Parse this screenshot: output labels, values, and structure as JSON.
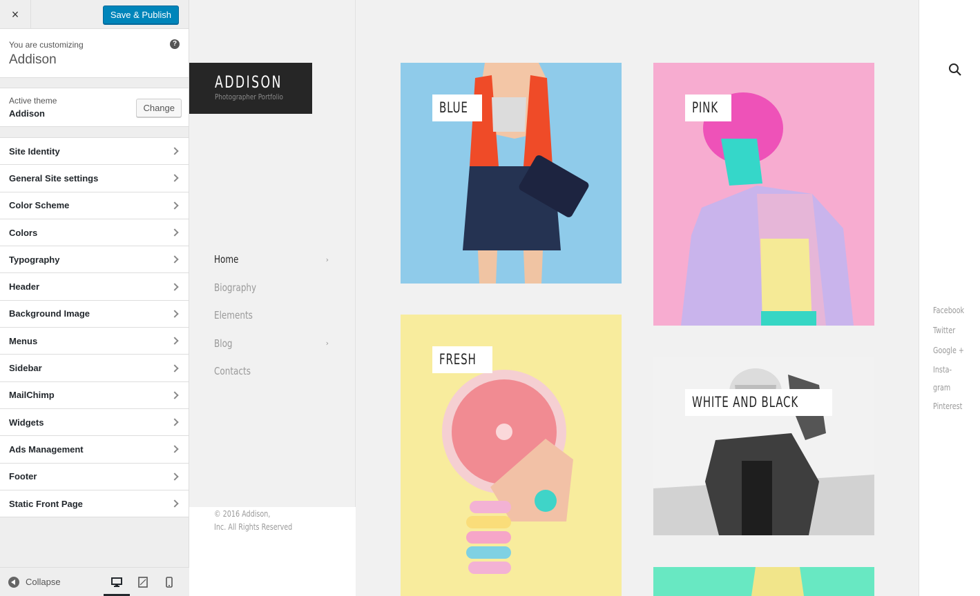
{
  "customizer": {
    "close_label": "×",
    "save_label": "Save & Publish",
    "customizing_label": "You are customizing",
    "site_name": "Addison",
    "help_label": "?",
    "active_theme_label": "Active theme",
    "active_theme_name": "Addison",
    "change_label": "Change",
    "sections": [
      "Site Identity",
      "General Site settings",
      "Color Scheme",
      "Colors",
      "Typography",
      "Header",
      "Background Image",
      "Menus",
      "Sidebar",
      "MailChimp",
      "Widgets",
      "Ads Management",
      "Footer",
      "Static Front Page"
    ],
    "collapse_label": "Collapse",
    "devices": [
      "desktop-icon",
      "tablet-icon",
      "mobile-icon"
    ],
    "active_device": "desktop"
  },
  "site": {
    "logo_title": "ADDISON",
    "logo_subtitle": "Photographer Portfolio",
    "nav": [
      {
        "label": "Home",
        "current": true,
        "has_submenu": true
      },
      {
        "label": "Biography",
        "current": false,
        "has_submenu": false
      },
      {
        "label": "Elements",
        "current": false,
        "has_submenu": false
      },
      {
        "label": "Blog",
        "current": false,
        "has_submenu": true
      },
      {
        "label": "Contacts",
        "current": false,
        "has_submenu": false
      }
    ],
    "copyright_line1": "© 2016 Addison,",
    "copyright_line2": "Inc. All Rights Reserved",
    "social": [
      "Facebook",
      "Twitter",
      "Google +",
      "Insta-",
      "gram",
      "Pinterest"
    ],
    "tiles": [
      {
        "label": "BLUE",
        "color": "#8fcbea"
      },
      {
        "label": "PINK",
        "color": "#f7acd0"
      },
      {
        "label": "FRESH",
        "color": "#f8ec9d"
      },
      {
        "label": "WHITE AND BLACK",
        "color": "#ececec"
      },
      {
        "label": "",
        "color": "#68e8c2"
      }
    ]
  },
  "colors": {
    "primary_button": "#0085ba",
    "dark": "#262626",
    "muted_text": "#9a9a9a"
  }
}
